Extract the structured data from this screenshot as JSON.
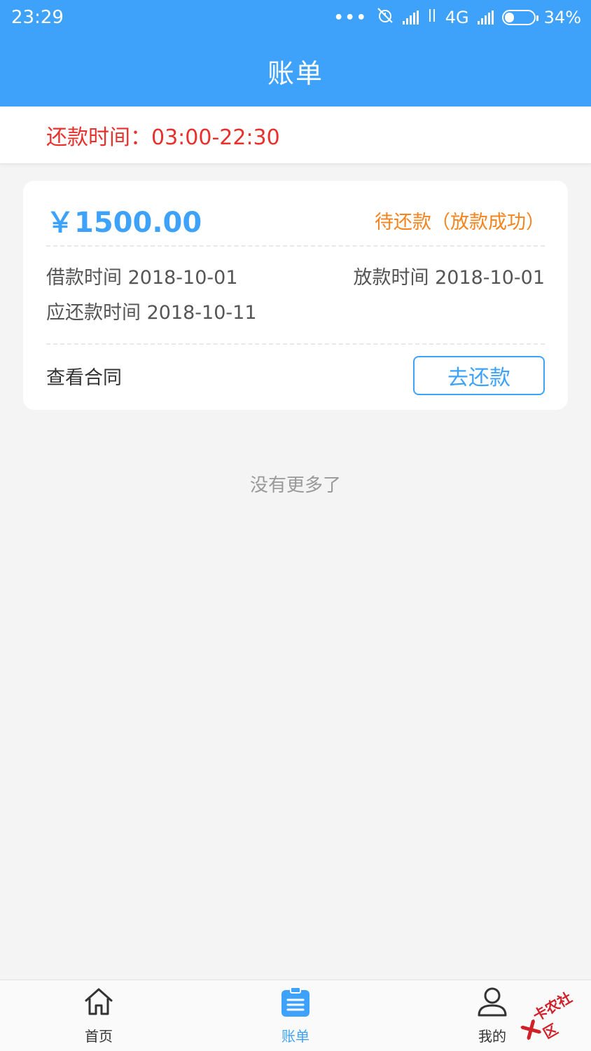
{
  "status_bar": {
    "time": "23:29",
    "dots": "•••",
    "network": "4G",
    "battery_percent": "34%",
    "battery_level": 0.34
  },
  "header": {
    "title": "账单"
  },
  "notice": {
    "text": "还款时间：03:00-22:30"
  },
  "bill": {
    "amount": "￥1500.00",
    "status": "待还款（放款成功）",
    "loan_time": "借款时间 2018-10-01",
    "disburse_time": "放款时间 2018-10-01",
    "due_time": "应还款时间 2018-10-11",
    "contract_link": "查看合同",
    "repay_button": "去还款"
  },
  "footer_note": "没有更多了",
  "tabs": [
    {
      "label": "首页",
      "icon": "home-icon",
      "active": false
    },
    {
      "label": "账单",
      "icon": "bill-icon",
      "active": true
    },
    {
      "label": "我的",
      "icon": "user-icon",
      "active": false
    }
  ],
  "watermark": {
    "text": "卡农社区"
  },
  "colors": {
    "brand": "#3ea2fb",
    "notice": "#e8312c",
    "status": "#f5841f"
  }
}
